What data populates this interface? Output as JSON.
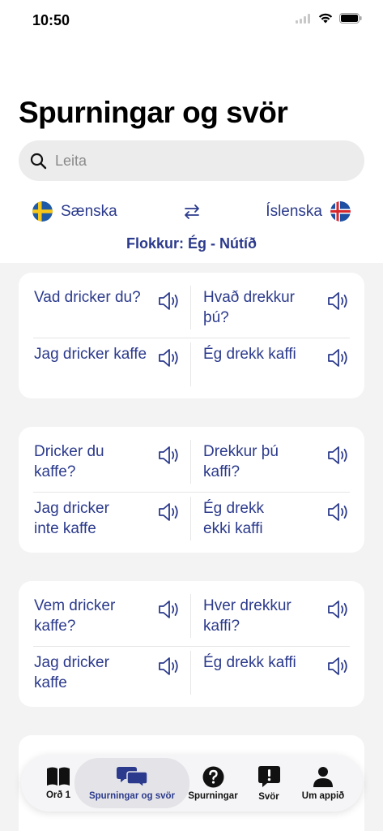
{
  "status": {
    "time": "10:50"
  },
  "header": {
    "title": "Spurningar og svör"
  },
  "search": {
    "placeholder": "Leita"
  },
  "languages": {
    "source": "Sænska",
    "target": "Íslenska",
    "category": "Flokkur: Ég - Nútíð"
  },
  "cards": [
    {
      "question": {
        "sv": "Vad dricker du?",
        "is": "Hvað drekkur þú?"
      },
      "answer": {
        "sv": "Jag dricker kaffe",
        "is": "Ég drekk kaffi"
      }
    },
    {
      "question": {
        "sv": "Dricker du kaffe?",
        "is": "Drekkur þú kaffi?"
      },
      "answer": {
        "sv": "Jag dricker inte kaffe",
        "is": "Ég drekk ekki kaffi"
      }
    },
    {
      "question": {
        "sv": "Vem dricker kaffe?",
        "is": "Hver drekkur kaffi?"
      },
      "answer": {
        "sv": "Jag dricker kaffe",
        "is": "Ég drekk kaffi"
      }
    }
  ],
  "tabs": [
    {
      "label": "Orð 1",
      "icon": "book-icon"
    },
    {
      "label": "Spurningar og svör",
      "icon": "chat-bubbles-icon",
      "active": true
    },
    {
      "label": "Spurningar",
      "icon": "question-icon"
    },
    {
      "label": "Svör",
      "icon": "exclamation-bubble-icon"
    },
    {
      "label": "Um appið",
      "icon": "person-icon"
    }
  ],
  "colors": {
    "accent": "#2b3a8c",
    "background": "#f3f3f3",
    "card": "#ffffff"
  }
}
